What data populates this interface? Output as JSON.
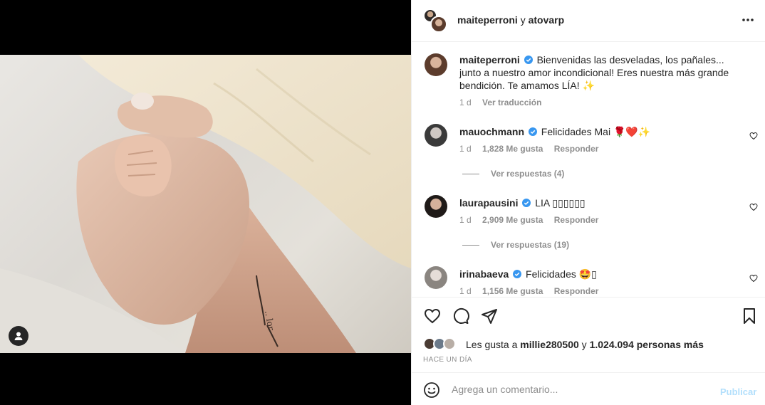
{
  "header": {
    "owner1": "maiteperroni",
    "connector": " y ",
    "owner2": "atovarp",
    "more_icon": "more-horizontal-icon"
  },
  "caption": {
    "user": "maiteperroni",
    "text": "Bienvenidas las desveladas, los pañales... junto a nuestro amor incondicional! Eres nuestra más grande bendición. Te amamos LÍA! ✨",
    "time": "1 d",
    "translate": "Ver traducción"
  },
  "comments": [
    {
      "user": "mauochmann",
      "text": "Felicidades Mai 🌹❤️✨",
      "time": "1 d",
      "likes": "1,828 Me gusta",
      "reply": "Responder",
      "view_replies": "Ver respuestas (4)"
    },
    {
      "user": "laurapausini",
      "text": "LIA ▯▯▯▯▯▯",
      "time": "1 d",
      "likes": "2,909 Me gusta",
      "reply": "Responder",
      "view_replies": "Ver respuestas (19)"
    },
    {
      "user": "irinabaeva",
      "text": "Felicidades 🤩▯",
      "time": "1 d",
      "likes": "1,156 Me gusta",
      "reply": "Responder"
    }
  ],
  "likes": {
    "prefix": "Les gusta a ",
    "user": "millie280500",
    "middle": " y ",
    "count": "1.024.094 personas más"
  },
  "posted_ago": "HACE UN DÍA",
  "add_comment": {
    "placeholder": "Agrega un comentario...",
    "publish": "Publicar"
  },
  "colors": {
    "verified": "#3897f0",
    "publish_disabled": "#b2dffc",
    "muted": "#8e8e8e"
  }
}
